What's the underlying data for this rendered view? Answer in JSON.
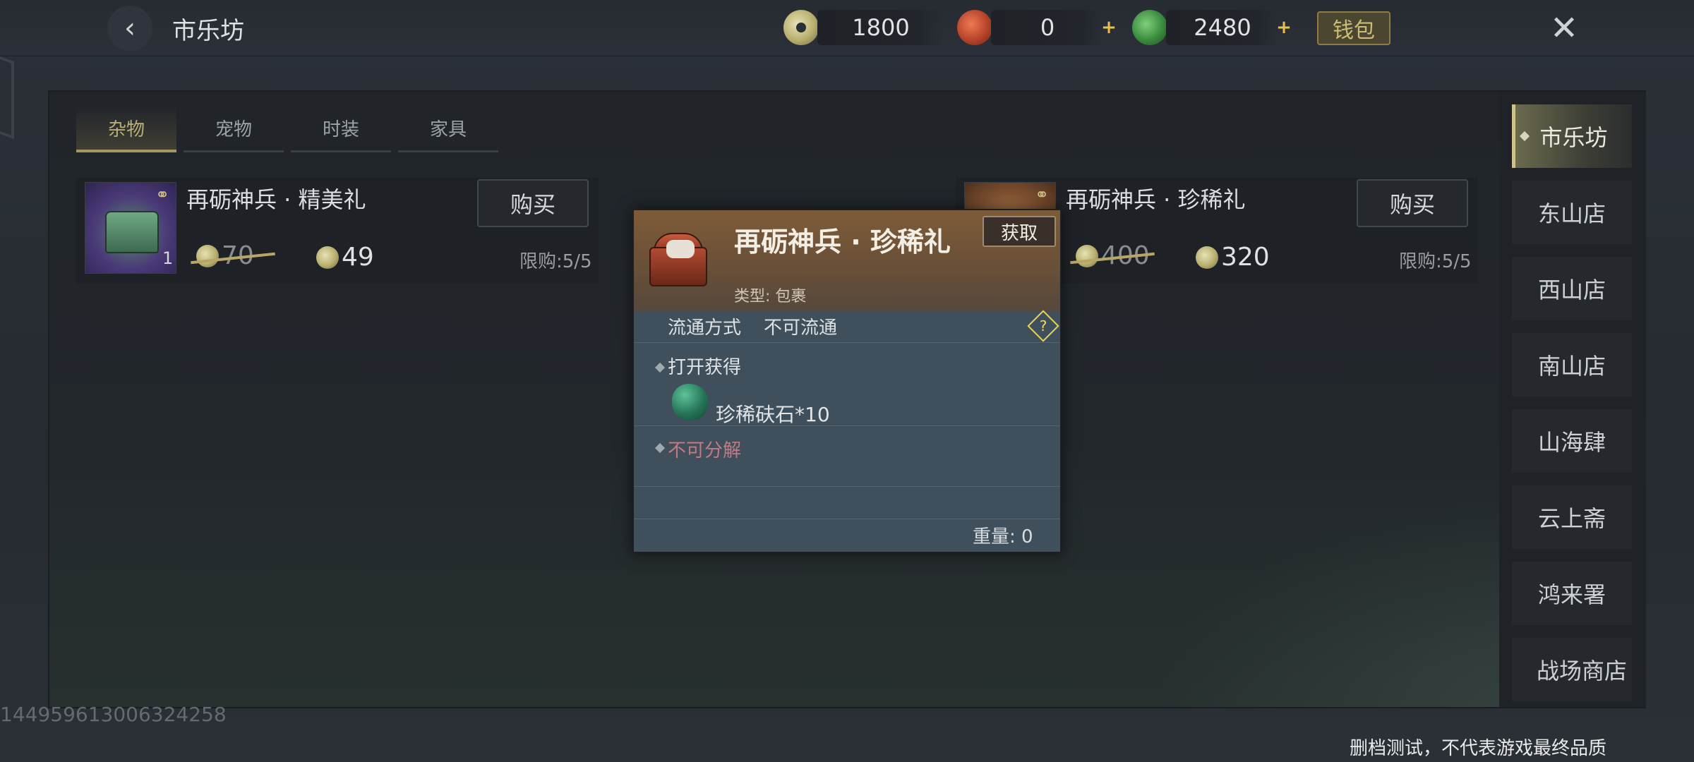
{
  "header": {
    "title": "市乐坊",
    "currencies": [
      {
        "name": "jade-coin",
        "value": "1800"
      },
      {
        "name": "red-token",
        "value": "0"
      },
      {
        "name": "green-jade",
        "value": "2480"
      }
    ],
    "wallet_label": "钱包"
  },
  "tabs": [
    {
      "label": "杂物",
      "active": true
    },
    {
      "label": "宠物",
      "active": false
    },
    {
      "label": "时装",
      "active": false
    },
    {
      "label": "家具",
      "active": false
    }
  ],
  "items": [
    {
      "name": "再砺神兵 · 精美礼",
      "quantity": "1",
      "old_price": "70",
      "price": "49",
      "buy_label": "购买",
      "limit": "限购:5/5"
    },
    {
      "name": "再砺神兵 · 珍稀礼",
      "quantity": "",
      "old_price": "400",
      "price": "320",
      "buy_label": "购买",
      "limit": "限购:5/5"
    }
  ],
  "shops": [
    {
      "label": "市乐坊",
      "active": true
    },
    {
      "label": "东山店",
      "active": false
    },
    {
      "label": "西山店",
      "active": false
    },
    {
      "label": "南山店",
      "active": false
    },
    {
      "label": "山海肆",
      "active": false
    },
    {
      "label": "云上斋",
      "active": false
    },
    {
      "label": "鸿来署",
      "active": false
    },
    {
      "label": "战场商店",
      "active": false
    }
  ],
  "popup": {
    "title": "再砺神兵 · 珍稀礼",
    "get_label": "获取",
    "type": "类型: 包裹",
    "flow_label": "流通方式",
    "flow_value": "不可流通",
    "help_symbol": "?",
    "open_label": "打开获得",
    "reward": "珍稀砆石*10",
    "no_decompose": "不可分解",
    "weight": "重量: 0"
  },
  "footer": {
    "uid": "14495961300632425​8",
    "disclaimer": "删档测试，不代表游戏最终品质"
  },
  "icons": {
    "back": "back-arrow-icon",
    "close": "close-icon",
    "link": "link-icon",
    "help": "help-icon"
  }
}
